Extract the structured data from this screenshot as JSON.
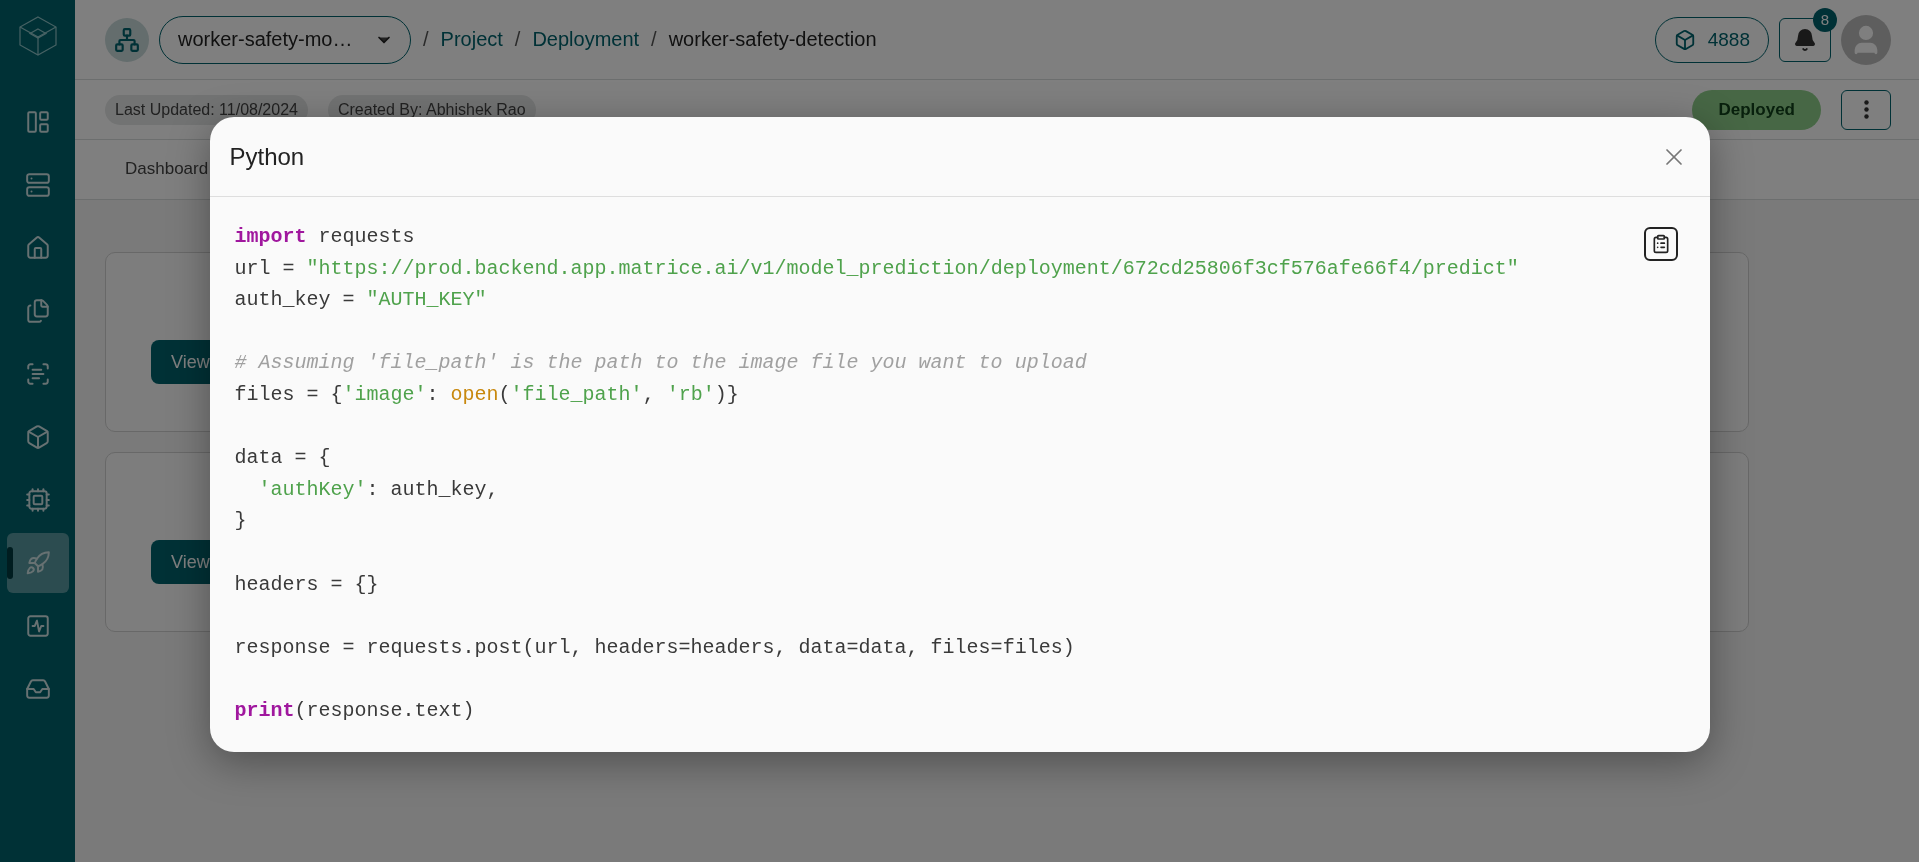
{
  "sidebar": {
    "items": [
      {
        "selected": false
      },
      {
        "selected": false
      },
      {
        "selected": false
      },
      {
        "selected": false
      },
      {
        "selected": false
      },
      {
        "selected": false
      },
      {
        "selected": false
      },
      {
        "selected": true
      },
      {
        "selected": false
      },
      {
        "selected": false
      }
    ]
  },
  "header": {
    "project_select": "worker-safety-mo…",
    "breadcrumb": [
      {
        "separator": "/",
        "label": "Project",
        "link": true
      },
      {
        "separator": "/",
        "label": "Deployment",
        "link": true
      },
      {
        "separator": "/",
        "label": "worker-safety-detection",
        "link": false
      }
    ],
    "credits": "4888",
    "notifications": "8"
  },
  "info_bar": {
    "chips": [
      "Last Updated: 11/08/2024",
      "Created By: Abhishek Rao"
    ],
    "status": "Deployed"
  },
  "tabs": [
    {
      "label": "Dashboard",
      "selected": false
    }
  ],
  "cards": [
    {
      "button": "View"
    },
    {
      "button": "View"
    }
  ],
  "modal": {
    "title": "Python",
    "code": [
      {
        "kind": "code",
        "tokens": [
          {
            "kind": "keyword",
            "text": "import"
          },
          {
            "kind": "plain",
            "text": " requests"
          }
        ]
      },
      {
        "kind": "code",
        "tokens": [
          {
            "kind": "plain",
            "text": "url = "
          },
          {
            "kind": "string",
            "text": "\"https://prod.backend.app.matrice.ai/v1/model_prediction/deployment/672cd25806f3cf576afe66f4/predict\""
          }
        ]
      },
      {
        "kind": "code",
        "tokens": [
          {
            "kind": "plain",
            "text": "auth_key = "
          },
          {
            "kind": "string",
            "text": "\"AUTH_KEY\""
          }
        ]
      },
      {
        "kind": "blank"
      },
      {
        "kind": "code",
        "tokens": [
          {
            "kind": "comment",
            "text": "# Assuming 'file_path' is the path to the image file you want to upload"
          }
        ]
      },
      {
        "kind": "code",
        "tokens": [
          {
            "kind": "plain",
            "text": "files = {"
          },
          {
            "kind": "string",
            "text": "'image'"
          },
          {
            "kind": "plain",
            "text": ": "
          },
          {
            "kind": "builtin",
            "text": "open"
          },
          {
            "kind": "plain",
            "text": "("
          },
          {
            "kind": "string",
            "text": "'file_path'"
          },
          {
            "kind": "plain",
            "text": ", "
          },
          {
            "kind": "string",
            "text": "'rb'"
          },
          {
            "kind": "plain",
            "text": ")}"
          }
        ]
      },
      {
        "kind": "blank"
      },
      {
        "kind": "code",
        "tokens": [
          {
            "kind": "plain",
            "text": "data = {"
          }
        ]
      },
      {
        "kind": "indented",
        "tokens": [
          {
            "kind": "string",
            "text": "'authKey'"
          },
          {
            "kind": "plain",
            "text": ": auth_key,"
          }
        ]
      },
      {
        "kind": "code",
        "tokens": [
          {
            "kind": "plain",
            "text": "}"
          }
        ]
      },
      {
        "kind": "blank"
      },
      {
        "kind": "code",
        "tokens": [
          {
            "kind": "plain",
            "text": "headers = {}"
          }
        ]
      },
      {
        "kind": "blank"
      },
      {
        "kind": "code",
        "tokens": [
          {
            "kind": "plain",
            "text": "response = requests.post(url, headers=headers, data=data, files=files)"
          }
        ]
      },
      {
        "kind": "blank"
      },
      {
        "kind": "code",
        "tokens": [
          {
            "kind": "keyword",
            "text": "print"
          },
          {
            "kind": "plain",
            "text": "(response.text)"
          }
        ]
      }
    ]
  }
}
